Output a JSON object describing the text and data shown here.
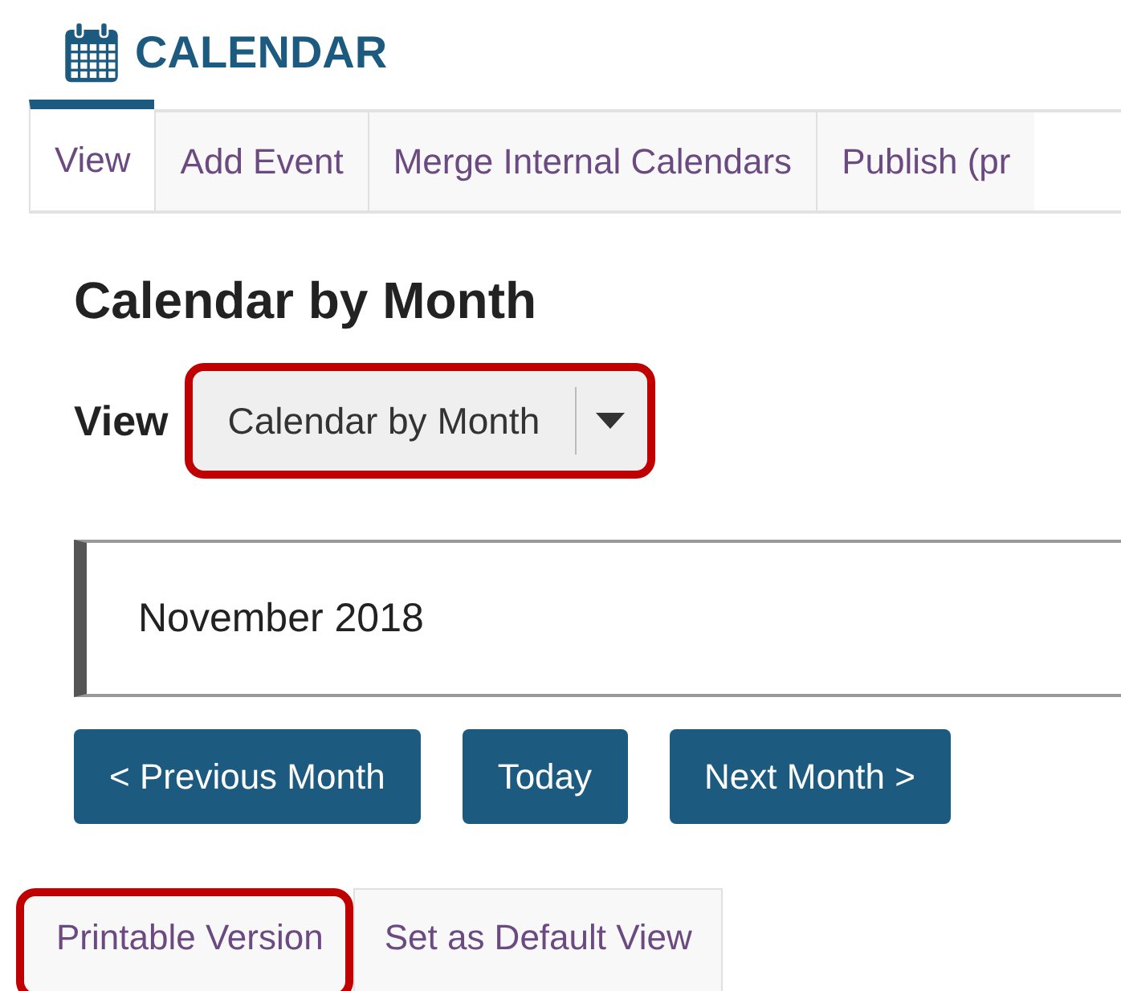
{
  "tool": {
    "title": "CALENDAR"
  },
  "tabs": [
    {
      "label": "View",
      "selected": true
    },
    {
      "label": "Add Event",
      "selected": false
    },
    {
      "label": "Merge Internal Calendars",
      "selected": false
    },
    {
      "label": "Publish (pr",
      "selected": false
    }
  ],
  "heading": "Calendar by Month",
  "view_select": {
    "label": "View",
    "value": "Calendar by Month",
    "highlighted": true
  },
  "period": "November 2018",
  "nav_buttons": [
    "< Previous Month",
    "Today",
    "Next Month >"
  ],
  "bottom_tabs": [
    {
      "label": "Printable Version",
      "highlighted": true
    },
    {
      "label": "Set as Default View",
      "highlighted": false
    }
  ]
}
